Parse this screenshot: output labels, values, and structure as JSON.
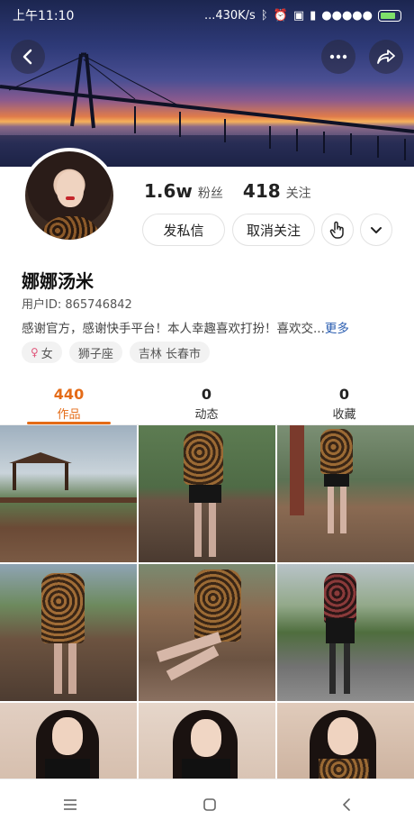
{
  "status_bar": {
    "time": "上午11:10",
    "network_speed": "...430K/s",
    "signal_dots": "●●●●●"
  },
  "header": {
    "back_icon": "back-chevron-icon",
    "more_icon": "more-dots-icon",
    "share_icon": "share-icon"
  },
  "profile": {
    "followers_count": "1.6w",
    "followers_label": "粉丝",
    "following_count": "418",
    "following_label": "关注",
    "message_button": "发私信",
    "unfollow_button": "取消关注",
    "name": "娜娜汤米",
    "user_id": "用户ID: 865746842",
    "bio": "感谢官方，感谢快手平台！本人幸趣喜欢打扮！喜欢交...",
    "bio_more": "更多",
    "tags": [
      "女",
      "狮子座",
      "吉林 长春市"
    ]
  },
  "tabs": [
    {
      "count": "440",
      "label": "作品",
      "active": true
    },
    {
      "count": "0",
      "label": "动态",
      "active": false
    },
    {
      "count": "0",
      "label": "收藏",
      "active": false
    }
  ],
  "colors": {
    "accent": "#e46b17",
    "link": "#2a5db0"
  },
  "bottom_nav": {
    "menu_icon": "menu-icon",
    "home_icon": "home-square-icon",
    "back_icon": "back-triangle-icon"
  }
}
